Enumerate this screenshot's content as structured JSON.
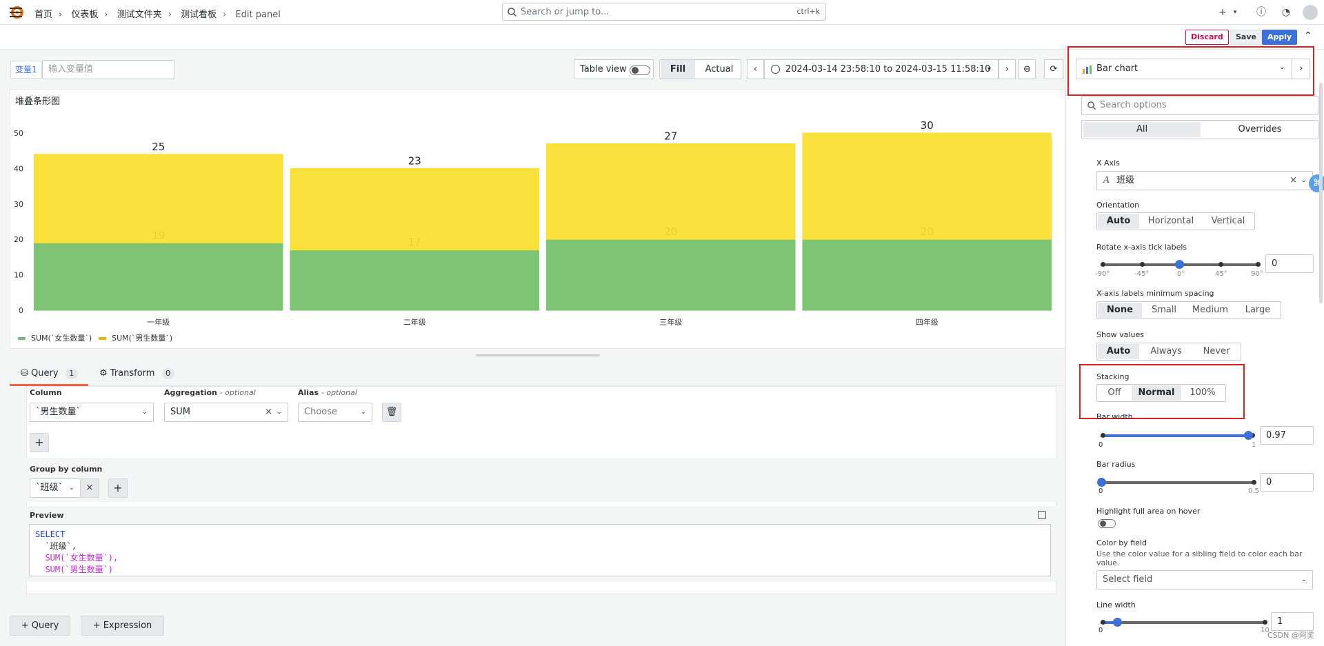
{
  "topbar": {
    "search_placeholder": "Search or jump to...",
    "search_shortcut": "ctrl+k"
  },
  "breadcrumb": [
    "首页",
    "仪表板",
    "测试文件夹",
    "测试看板",
    "Edit panel"
  ],
  "actions": {
    "discard": "Discard",
    "save": "Save",
    "apply": "Apply"
  },
  "variables": {
    "label": "变量1",
    "placeholder": "输入变量值"
  },
  "toolbar": {
    "table_view": "Table view",
    "fill": "Fill",
    "actual": "Actual",
    "time_range": "2024-03-14 23:58:10 to 2024-03-15 11:58:10"
  },
  "panel": {
    "title": "堆叠条形图"
  },
  "chart_data": {
    "type": "bar",
    "stacked": true,
    "title": "堆叠条形图",
    "categories": [
      "一年级",
      "二年级",
      "三年级",
      "四年级"
    ],
    "series": [
      {
        "name": "SUM(`女生数量`)",
        "values": [
          19,
          17,
          20,
          20
        ],
        "color": "#73bf69"
      },
      {
        "name": "SUM(`男生数量`)",
        "values": [
          25,
          23,
          27,
          30
        ],
        "color": "#fade2a"
      }
    ],
    "y_ticks": [
      0,
      10,
      20,
      30,
      40,
      50
    ],
    "ylim": [
      0,
      50
    ],
    "legend_position": "bottom-left",
    "grid": false
  },
  "tabs": {
    "query": {
      "label": "Query",
      "count": "1"
    },
    "transform": {
      "label": "Transform",
      "count": "0"
    }
  },
  "query": {
    "column_label": "Column",
    "column_value": "`男生数量`",
    "aggregation_label": "Aggregation",
    "aggregation_value": "SUM",
    "optional": "- optional",
    "alias_label": "Alias",
    "alias_placeholder": "Choose",
    "groupby_label": "Group by column",
    "groupby_value": "`班级`",
    "preview_label": "Preview",
    "sql": [
      "SELECT",
      "  `班级`,",
      "  SUM(`女生数量`),",
      "  SUM(`男生数量`)"
    ]
  },
  "bottom_buttons": {
    "add_query": "Query",
    "add_expression": "Expression"
  },
  "options": {
    "viz": "Bar chart",
    "search_placeholder": "Search options",
    "all": "All",
    "overrides": "Overrides",
    "x_axis_label": "X Axis",
    "x_axis_value": "班级",
    "orientation_label": "Orientation",
    "orientation": [
      "Auto",
      "Horizontal",
      "Vertical"
    ],
    "rotate_label": "Rotate x-axis tick labels",
    "rotate_ticks": [
      "-90°",
      "-45°",
      "0°",
      "45°",
      "90°"
    ],
    "rotate_value": "0",
    "spacing_label": "X-axis labels minimum spacing",
    "spacing": [
      "None",
      "Small",
      "Medium",
      "Large"
    ],
    "show_values_label": "Show values",
    "show_values": [
      "Auto",
      "Always",
      "Never"
    ],
    "stacking_label": "Stacking",
    "stacking": [
      "Off",
      "Normal",
      "100%"
    ],
    "bar_width_label": "Bar width",
    "bar_width_min": "0",
    "bar_width_max": "1",
    "bar_width_value": "0.97",
    "bar_radius_label": "Bar radius",
    "bar_radius_min": "0",
    "bar_radius_max": "0.5",
    "bar_radius_value": "0",
    "highlight_label": "Highlight full area on hover",
    "color_by_label": "Color by field",
    "color_by_desc": "Use the color value for a sibling field to color each bar value.",
    "color_by_placeholder": "Select field",
    "line_width_label": "Line width",
    "line_width_min": "0",
    "line_width_max": "10",
    "line_width_value": "1"
  },
  "watermark": "CSDN @阿奖"
}
